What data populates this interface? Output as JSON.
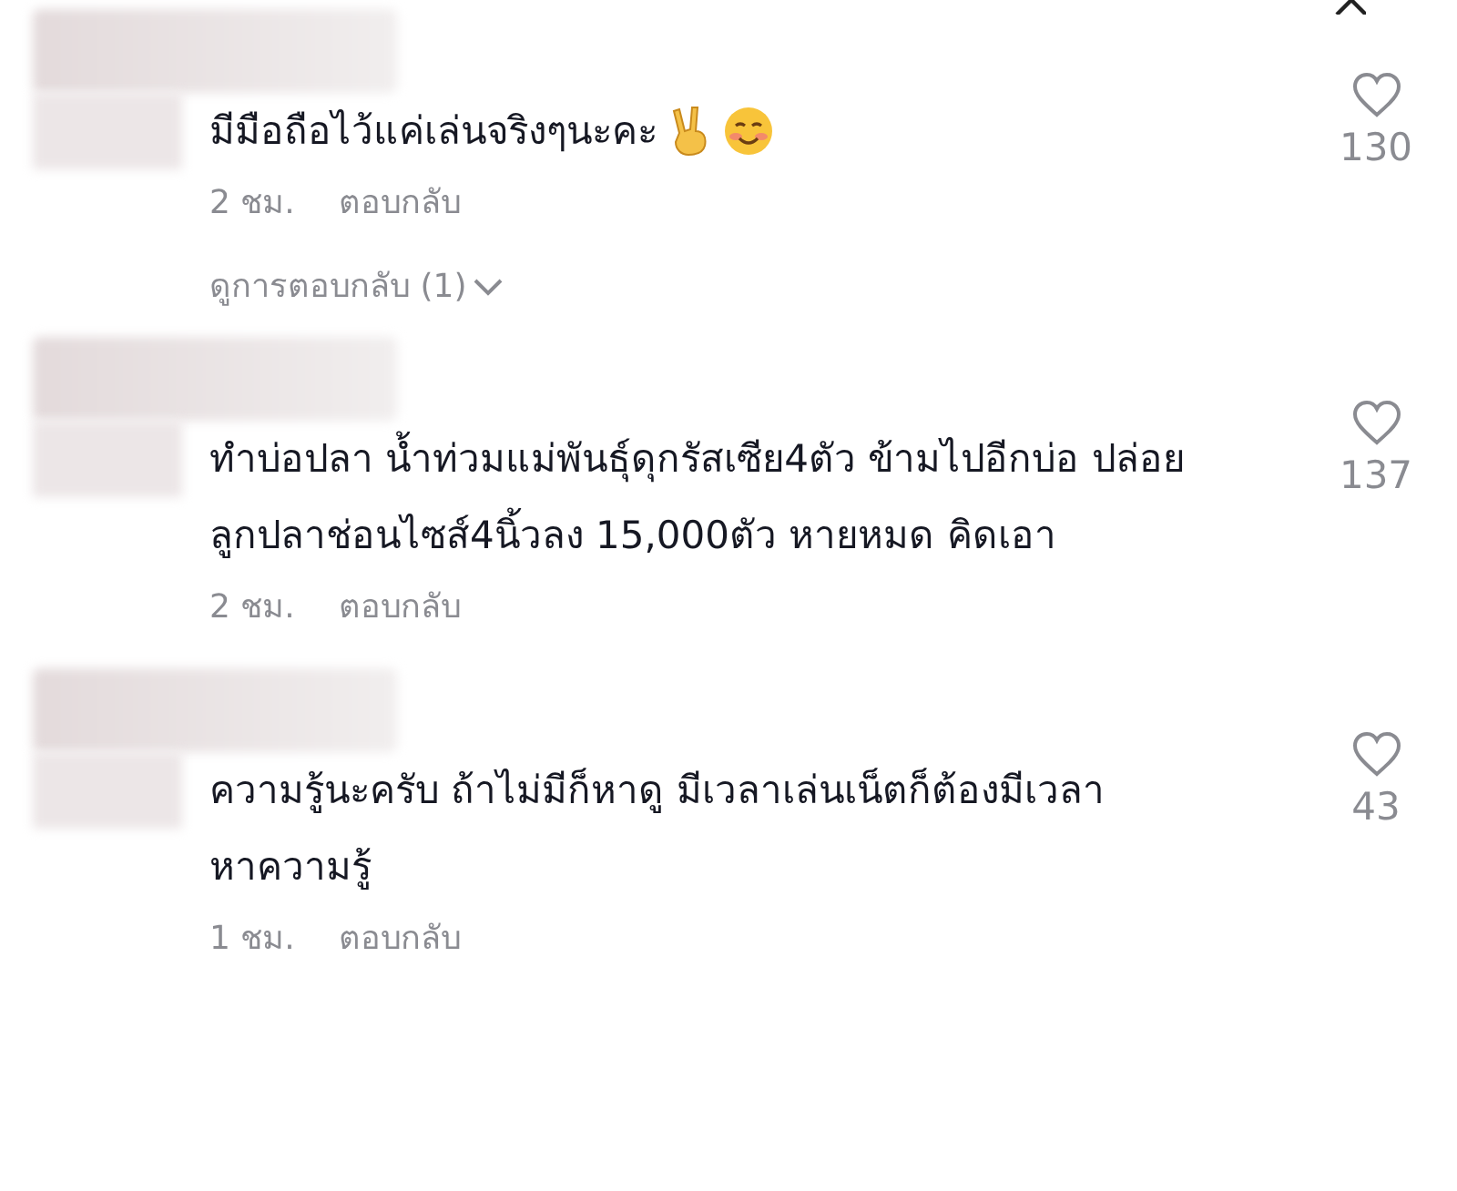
{
  "comments": [
    {
      "text": "มีมือถือไว้แค่เล่นจริงๆนะคะ",
      "emoji": [
        {
          "kind": "victory-hand"
        },
        {
          "kind": "smiling-face"
        }
      ],
      "time": "2 ชม.",
      "reply": "ตอบกลับ",
      "likes": "130",
      "view_replies": "ดูการตอบกลับ (1)"
    },
    {
      "text": "ทำบ่อปลา น้ำท่วมแม่พันธุ์ดุกรัสเซีย4ตัว ข้ามไปอีกบ่อ ปล่อยลูกปลาช่อนไซส์4นิ้วลง 15,000ตัว หายหมด คิดเอา",
      "time": "2 ชม.",
      "reply": "ตอบกลับ",
      "likes": "137"
    },
    {
      "text": "ความรู้นะครับ ถ้าไม่มีก็หาดู มีเวลาเล่นเน็ตก็ต้องมีเวลาหาความรู้",
      "time": "1 ชม.",
      "reply": "ตอบกลับ",
      "likes": "43"
    }
  ]
}
